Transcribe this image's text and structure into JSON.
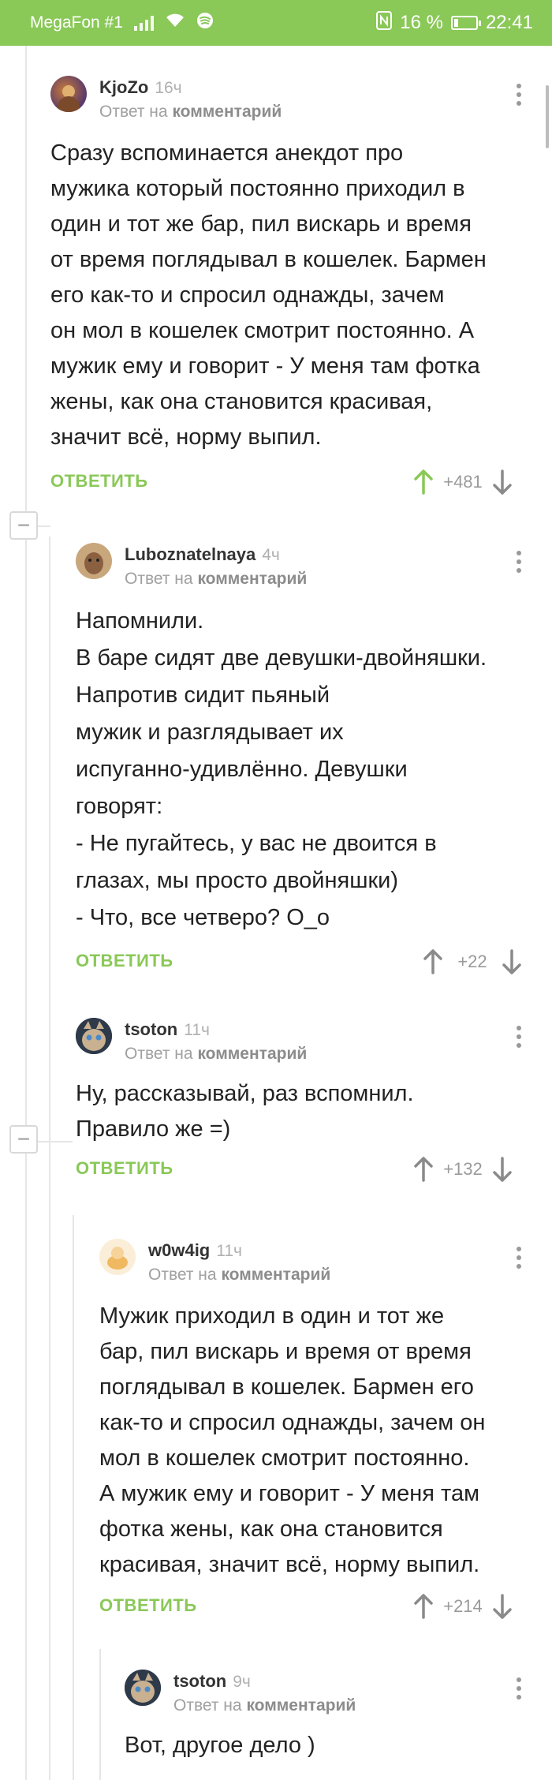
{
  "status_bar": {
    "carrier": "MegaFon #1",
    "battery_text": "16 %",
    "time": "22:41",
    "icons": [
      "signal-icon",
      "wifi-icon",
      "spotify-icon",
      "nfc-icon",
      "battery-icon"
    ]
  },
  "colors": {
    "accent": "#8ac858",
    "upvote_active": "#8ac858",
    "thread_line": "#e6e6e6"
  },
  "comments": [
    {
      "author": "KjoZo",
      "time": "16ч",
      "reply_prefix": "Ответ на",
      "reply_target": "комментарий",
      "body": "Сразу вспоминается анекдот про\nмужика который постоянно приходил в\nодин и тот же бар, пил вискарь и время\nот время поглядывал в кошелек. Бармен\nего как-то и спросил однажды, зачем\nон мол в кошелек смотрит постоянно. А\nмужик ему и говорит - У меня там фотка\nжены, как она становится красивая,\nзначит всё, норму выпил.",
      "reply_label": "ОТВЕТИТЬ",
      "score": "+481",
      "upvoted": true
    },
    {
      "author": "Luboznatelnaya",
      "time": "4ч",
      "reply_prefix": "Ответ на",
      "reply_target": "комментарий",
      "body": "Напомнили.\nВ баре сидят две девушки-двойняшки.\nНапротив сидит пьяный\nмужик и разглядывает их\nиспуганно-удивлённо. Девушки\nговорят:\n- Не пугайтесь, у вас не двоится в\nглазах, мы просто двойняшки)\n- Что, все четверо? О_о",
      "reply_label": "ОТВЕТИТЬ",
      "score": "+22",
      "upvoted": false
    },
    {
      "author": "tsoton",
      "time": "11ч",
      "reply_prefix": "Ответ на",
      "reply_target": "комментарий",
      "body": "Ну, рассказывай, раз вспомнил.\nПравило же =)",
      "reply_label": "ОТВЕТИТЬ",
      "score": "+132",
      "upvoted": false
    },
    {
      "author": "w0w4ig",
      "time": "11ч",
      "reply_prefix": "Ответ на",
      "reply_target": "комментарий",
      "body": "Мужик приходил в один и тот же\nбар, пил вискарь и время от время\nпоглядывал в кошелек. Бармен его\nкак-то и спросил однажды, зачем он\nмол в кошелек смотрит постоянно.\nА мужик ему и говорит - У меня там\nфотка жены, как она становится\nкрасивая, значит всё, норму выпил.",
      "reply_label": "ОТВЕТИТЬ",
      "score": "+214",
      "upvoted": false
    },
    {
      "author": "tsoton",
      "time": "9ч",
      "reply_prefix": "Ответ на",
      "reply_target": "комментарий",
      "body": "Вот, другое дело )"
    }
  ]
}
